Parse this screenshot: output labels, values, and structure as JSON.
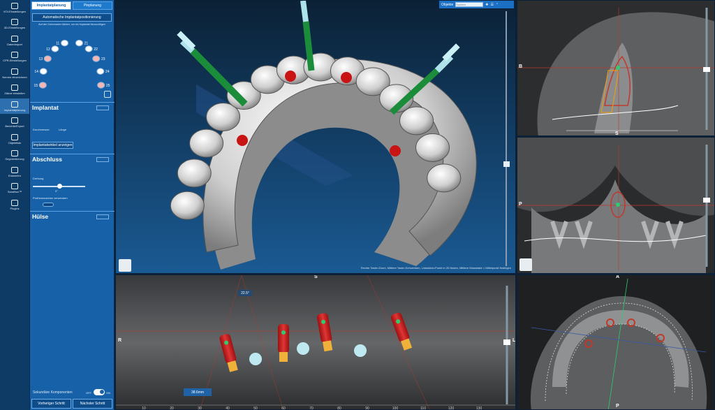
{
  "toolbar": {
    "items": [
      {
        "label": "VOI-Einstellungen",
        "icon": "cube-icon"
      },
      {
        "label": "3D-Einstellungen",
        "icon": "gear-icon"
      },
      {
        "label": "Datenimport",
        "icon": "download-icon"
      },
      {
        "label": "CPR-Einstellungen",
        "icon": "curve-icon"
      },
      {
        "label": "Nerven einzeichnen",
        "icon": "nerve-icon"
      },
      {
        "label": "Zähne einstellen",
        "icon": "tooth-icon"
      },
      {
        "label": "Implantatplanung",
        "icon": "implant-icon"
      },
      {
        "label": "Berichte/Export",
        "icon": "report-icon"
      },
      {
        "label": "Objektliste",
        "icon": "list-icon"
      },
      {
        "label": "Segmentierung",
        "icon": "segment-icon"
      },
      {
        "label": "Entwerfen",
        "icon": "design-icon"
      },
      {
        "label": "SandBox™",
        "icon": "sandbox-icon"
      },
      {
        "label": "Plugins",
        "icon": "plugin-icon"
      }
    ]
  },
  "panel": {
    "tabs": [
      "Implantatplanung",
      "Pinplanung"
    ],
    "auto_button": "Automatische Implantatpositionierung",
    "hint": "Auf den Zahnmarker klicken, um ein Implantat hinzuzufügen",
    "tooth_numbers": [
      "11",
      "12",
      "13",
      "14",
      "15",
      "16",
      "17",
      "18",
      "21",
      "22",
      "23",
      "24",
      "25",
      "26",
      "27",
      "28"
    ],
    "implant_title": "Implantat",
    "diameter_label": "Durchmesser",
    "length_label": "Länge",
    "axis_button": "Implantatwinkel anzeigen",
    "closure_title": "Abschluss",
    "rotation_label": "Drehung",
    "rotation_value": "0°",
    "prosthetic_label": "Prothesenachse verwenden",
    "sleeve_title": "Hülse",
    "secondary_label": "Sekundäre Komponenten",
    "off": "OFF",
    "on": "ON",
    "prev_button": "Vorheriger Schritt",
    "next_button": "Nächster Schritt"
  },
  "viewport3d": {
    "objects_label": "Objekte",
    "search_placeholder": "Suchen",
    "hint": "Rechte Taste=Zoom, Mittlere Taste=Schwenken, Linksklick=Punkt in 2D finden, Mittlere Maustaste = Mittelpunkt festlegen"
  },
  "pano": {
    "angle": "22.5°",
    "measure": "38.6mm",
    "orient_left": "R",
    "orient_right": "L",
    "orient_top": "S",
    "ruler": [
      "10",
      "20",
      "30",
      "40",
      "50",
      "60",
      "70",
      "80",
      "90",
      "100",
      "110",
      "120",
      "130"
    ]
  },
  "sagittal": {
    "orient_top": "S",
    "orient_left": "B",
    "orient_bottom": "S"
  },
  "coronal": {
    "orient_left": "P",
    "orient_top": "S"
  },
  "axial": {
    "orient_top": "A",
    "orient_bottom": "P"
  }
}
